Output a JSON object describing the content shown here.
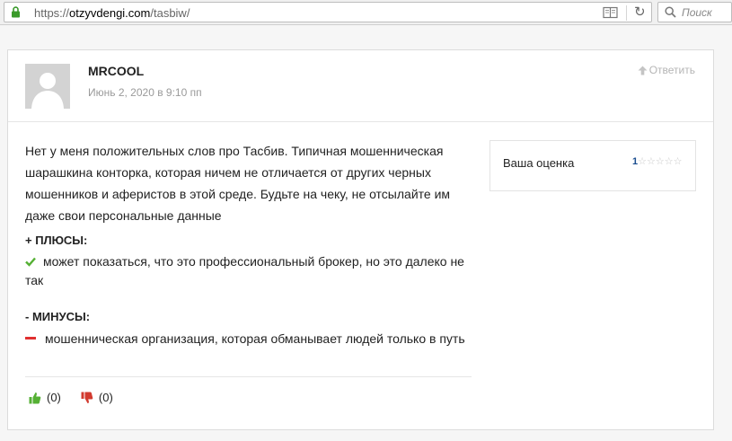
{
  "browser": {
    "url_domain": "otzyvdengi.com",
    "url_prefix": "https://",
    "url_path": "/tasbiw/",
    "search_placeholder": "Поиск"
  },
  "review": {
    "author": "MRCOOL",
    "date": "Июнь 2, 2020 в 9:10 пп",
    "reply_label": "Ответить",
    "text": "Нет у меня положительных слов про Тасбив. Типичная мошенническая шарашкина конторка, которая ничем не отличается от других черных мошенников и аферистов в этой среде. Будьте на чеку, не отсылайте им даже свои персональные данные",
    "pros_title": "+ ПЛЮСЫ:",
    "pros_item": "может показаться, что это профессиональный брокер, но это далеко не так",
    "cons_title": "- МИНУСЫ:",
    "cons_item": "мошенническая организация, которая обманывает людей только в путь",
    "likes": "(0)",
    "dislikes": "(0)"
  },
  "rating": {
    "label": "Ваша оценка",
    "value": "1",
    "max_stars": 5
  },
  "colors": {
    "pros_icon": "#55b034",
    "cons_icon": "#e03030",
    "dislike": "#d23a2f"
  }
}
